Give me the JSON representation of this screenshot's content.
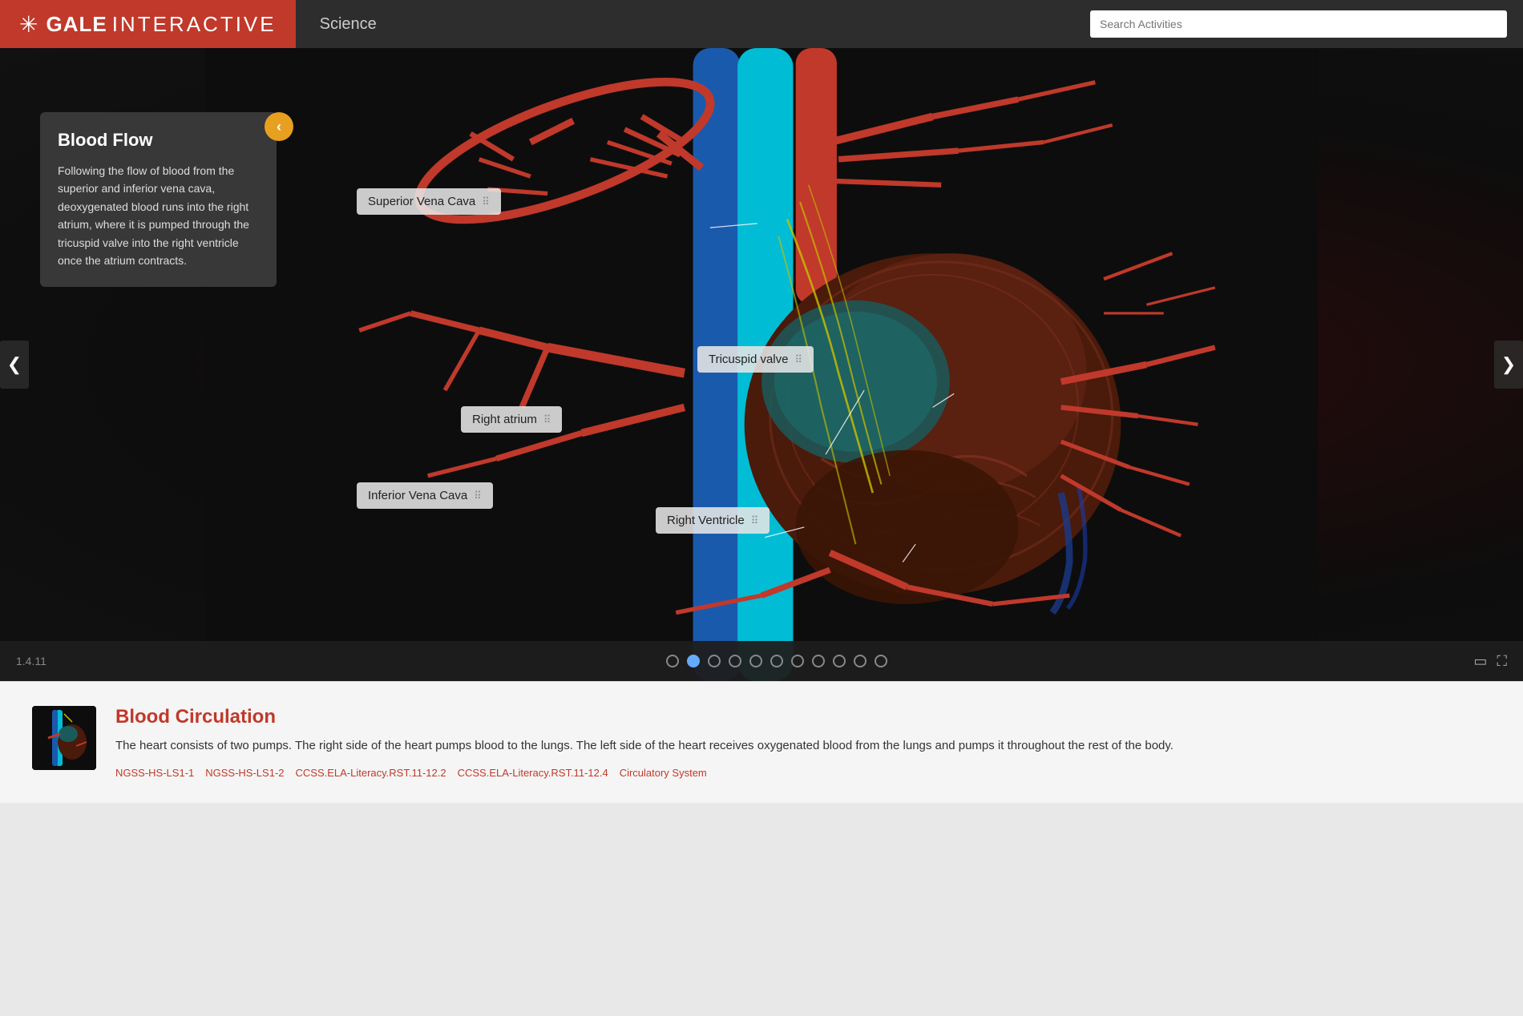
{
  "header": {
    "logo_gale": "GALE",
    "logo_interactive": "INTERACTIVE",
    "section": "Science",
    "search_placeholder": "Search Activities"
  },
  "info_panel": {
    "title": "Blood Flow",
    "body": "Following the flow of blood from the superior and inferior vena cava, deoxygenated blood runs into the right atrium, where it is pumped through the tricuspid valve into the right ventricle once the atrium contracts.",
    "collapse_icon": "‹"
  },
  "labels": [
    {
      "id": "superior-vena-cava",
      "text": "Superior Vena Cava",
      "top": "185",
      "left": "445"
    },
    {
      "id": "tricuspid-valve",
      "text": "Tricuspid valve",
      "top": "378",
      "left": "875"
    },
    {
      "id": "right-atrium",
      "text": "Right atrium",
      "top": "448",
      "left": "575"
    },
    {
      "id": "inferior-vena-cava",
      "text": "Inferior Vena Cava",
      "top": "544",
      "left": "445"
    },
    {
      "id": "right-ventricle",
      "text": "Right Ventricle",
      "top": "573",
      "left": "815"
    }
  ],
  "bottom_bar": {
    "version": "1.4.11",
    "dots_total": 11,
    "active_dot": 1
  },
  "info_section": {
    "title": "Blood Circulation",
    "body": "The heart consists of two pumps. The right side of the heart pumps blood to the lungs. The left side of the heart receives oxygenated blood from the lungs and pumps it throughout the rest of the body.",
    "tags": [
      "NGSS-HS-LS1-1",
      "NGSS-HS-LS1-2",
      "CCSS.ELA-Literacy.RST.11-12.2",
      "CCSS.ELA-Literacy.RST.11-12.4",
      "Circulatory System"
    ]
  },
  "nav": {
    "prev_icon": "❮",
    "next_icon": "❯"
  },
  "icons": {
    "drag": "⠿",
    "rect_icon": "▭",
    "expand_icon": "⛶"
  }
}
